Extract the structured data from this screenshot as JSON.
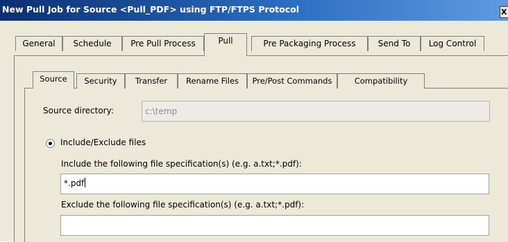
{
  "window": {
    "title": "New Pull Job for Source <Pull_PDF> using FTP/FTPS Protocol",
    "close_label": "X"
  },
  "outer_tabs": [
    {
      "label": "General"
    },
    {
      "label": "Schedule"
    },
    {
      "label": "Pre Pull Process"
    },
    {
      "label": "Pull",
      "selected": true
    },
    {
      "label": "Pre Packaging Process"
    },
    {
      "label": "Send To"
    },
    {
      "label": "Log Control"
    }
  ],
  "inner_tabs": [
    {
      "label": "Source",
      "selected": true
    },
    {
      "label": "Security"
    },
    {
      "label": "Transfer"
    },
    {
      "label": "Rename Files"
    },
    {
      "label": "Pre/Post Commands"
    },
    {
      "label": "Compatibility"
    }
  ],
  "source": {
    "directory_label": "Source directory:",
    "directory_value": "c:\\temp",
    "include_exclude_label": "Include/Exclude files",
    "include_exclude_selected": true,
    "include_label": "Include the following file specification(s) (e.g. a.txt;*.pdf):",
    "include_value": "*.pdf",
    "exclude_label": "Exclude the following file specification(s) (e.g. a.txt;*.pdf):",
    "exclude_value": ""
  }
}
